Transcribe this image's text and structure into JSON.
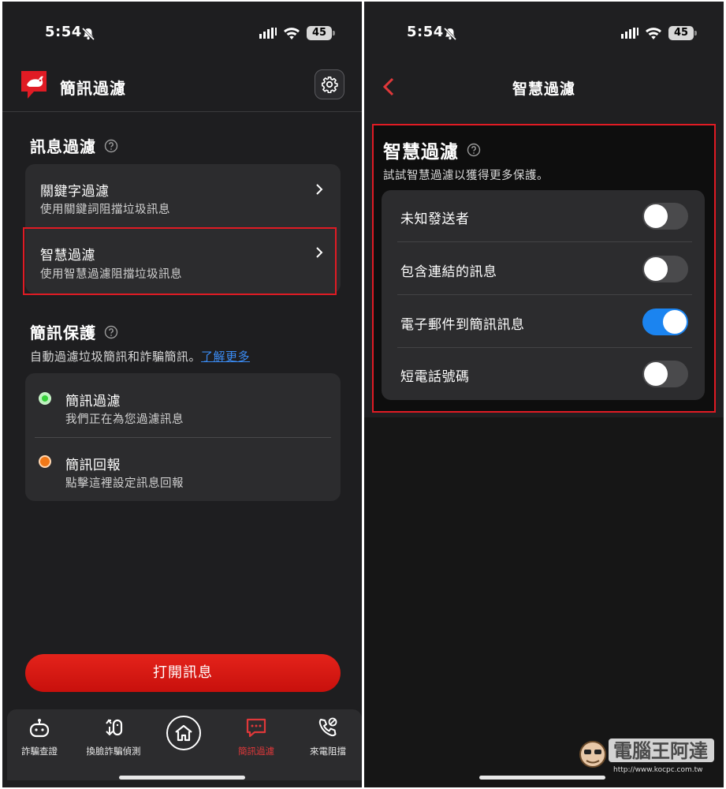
{
  "status_bar": {
    "time": "5:54",
    "battery": "45"
  },
  "left": {
    "app_title": "簡訊過濾",
    "section1": {
      "title": "訊息過濾"
    },
    "filters": [
      {
        "title": "關鍵字過濾",
        "subtitle": "使用關鍵詞阻擋垃圾訊息"
      },
      {
        "title": "智慧過濾",
        "subtitle": "使用智慧過濾阻擋垃圾訊息"
      }
    ],
    "section2": {
      "title": "簡訊保護",
      "description": "自動過濾垃圾簡訊和詐騙簡訊。",
      "link": "了解更多"
    },
    "protection": [
      {
        "title": "簡訊過濾",
        "subtitle": "我們正在為您過濾訊息",
        "color": "#36d03a"
      },
      {
        "title": "簡訊回報",
        "subtitle": "點擊這裡設定訊息回報",
        "color": "#f07818"
      }
    ],
    "open_button": "打開訊息",
    "tabs": [
      {
        "label": "詐騙查證",
        "icon": "robot-icon"
      },
      {
        "label": "換臉詐騙偵測",
        "icon": "face-swap-icon"
      },
      {
        "label": "",
        "icon": "home-icon"
      },
      {
        "label": "簡訊過濾",
        "icon": "message-icon",
        "active": true
      },
      {
        "label": "來電阻擋",
        "icon": "phone-block-icon"
      }
    ]
  },
  "right": {
    "nav_title": "智慧過濾",
    "panel_title": "智慧過濾",
    "panel_desc": "試試智慧過濾以獲得更多保護。",
    "toggles": [
      {
        "label": "未知發送者",
        "on": false
      },
      {
        "label": "包含連結的訊息",
        "on": false
      },
      {
        "label": "電子郵件到簡訊訊息",
        "on": true
      },
      {
        "label": "短電話號碼",
        "on": false
      }
    ]
  },
  "watermark": {
    "text": "電腦王阿達",
    "url": "http://www.kocpc.com.tw"
  },
  "colors": {
    "accent_red": "#e01b24",
    "toggle_on": "#1b84f0",
    "link": "#3b8cf4"
  }
}
